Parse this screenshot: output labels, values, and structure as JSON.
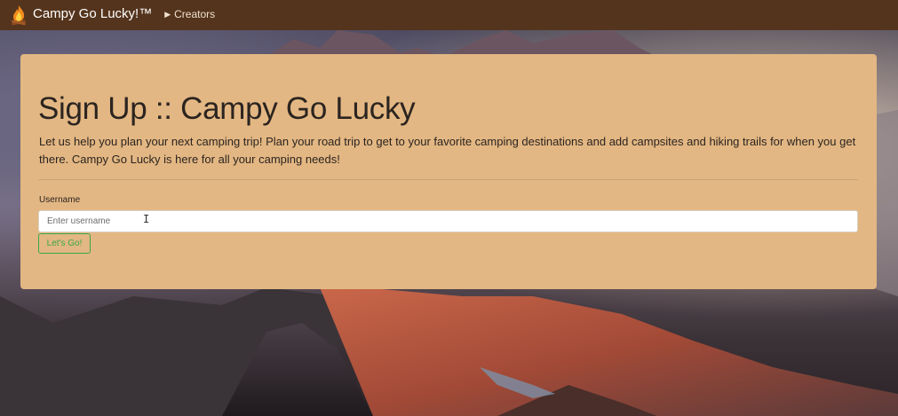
{
  "navbar": {
    "brand": "Campy Go Lucky!™",
    "links": [
      {
        "label": "Creators",
        "icon": "triangle-right-icon"
      }
    ],
    "logo_icon": "campfire-icon"
  },
  "signup": {
    "title": "Sign Up :: Campy Go Lucky",
    "lead": "Let us help you plan your next camping trip! Plan your road trip to get to your favorite camping destinations and add campsites and hiking trails for when you get there. Campy Go Lucky is here for all your camping needs!",
    "username_label": "Username",
    "username_placeholder": "Enter username",
    "username_value": "",
    "submit_label": "Let's Go!"
  },
  "colors": {
    "navbar_bg": "#54341c",
    "card_bg": "#e3b783",
    "button_accent": "#38a84a"
  }
}
